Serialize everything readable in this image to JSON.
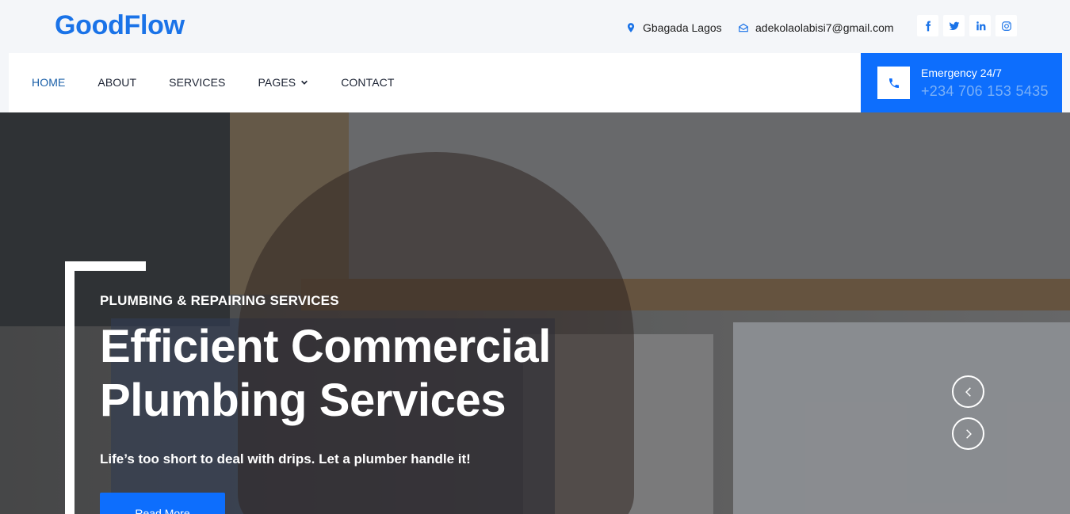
{
  "brand": {
    "name": "GoodFlow",
    "color": "#1a73e8"
  },
  "topbar": {
    "location": "Gbagada Lagos",
    "email": "adekolaolabisi7@gmail.com",
    "socials": [
      {
        "name": "facebook",
        "icon": "facebook-icon"
      },
      {
        "name": "twitter",
        "icon": "twitter-icon"
      },
      {
        "name": "linkedin",
        "icon": "linkedin-icon"
      },
      {
        "name": "instagram",
        "icon": "instagram-icon"
      }
    ]
  },
  "nav": {
    "items": [
      {
        "label": "HOME",
        "active": true
      },
      {
        "label": "ABOUT"
      },
      {
        "label": "SERVICES"
      },
      {
        "label": "PAGES",
        "dropdown": true
      },
      {
        "label": "CONTACT"
      }
    ]
  },
  "emergency": {
    "title": "Emergency 24/7",
    "phone": "+234 706 153 5435",
    "accent": "#0d6efd"
  },
  "hero": {
    "subtitle": "PLUMBING & REPAIRING SERVICES",
    "headline_line1": "Efficient Commercial",
    "headline_line2": "Plumbing Services",
    "tagline": "Life’s too short to deal with drips. Let a plumber handle it!",
    "cta_label": "Read More"
  }
}
